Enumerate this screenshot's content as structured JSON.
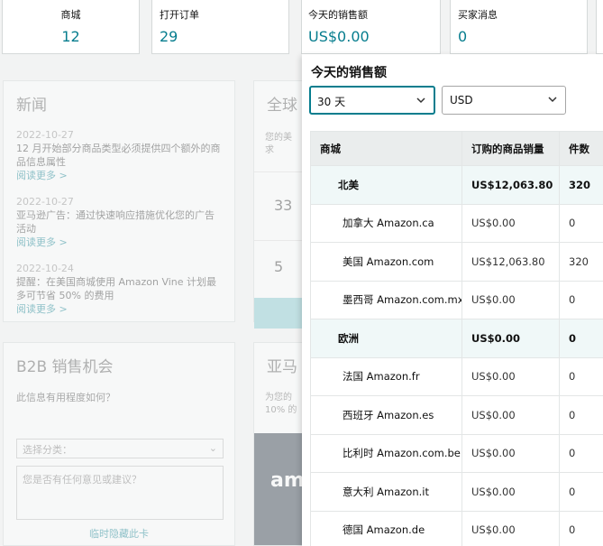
{
  "cards": [
    {
      "label": "商城",
      "value": "12"
    },
    {
      "label": "打开订单",
      "value": "29"
    },
    {
      "label": "今天的销售额",
      "value": "US$0.00"
    },
    {
      "label": "买家消息",
      "value": "0"
    }
  ],
  "news": {
    "title": "新闻",
    "items": [
      {
        "date": "2022-10-27",
        "text": "12 月开始部分商品类型必须提供四个额外的商品信息属性",
        "link": "阅读更多 >"
      },
      {
        "date": "2022-10-27",
        "text": "亚马逊广告：通过快速响应措施优化您的广告活动",
        "link": "阅读更多 >"
      },
      {
        "date": "2022-10-24",
        "text": "提醒：在美国商城使用 Amazon Vine 计划最多可节省 50% 的费用",
        "link": "阅读更多 >"
      }
    ]
  },
  "b2b": {
    "title": "B2B 销售机会",
    "question": "此信息有用程度如何？",
    "select_placeholder": "选择分类：",
    "text_placeholder": "您是否有任何意见或建议？",
    "hide_link": "临时隐藏此卡"
  },
  "global": {
    "title": "全球",
    "desc_line1": "您的美",
    "desc_line2": "求",
    "num1": "33",
    "num2": "5"
  },
  "amazon": {
    "title": "亚马",
    "desc_line1": "为您的",
    "desc_line2": "10% 的",
    "logo": "am"
  },
  "panel": {
    "title": "今天的销售额",
    "period": "30 天",
    "currency": "USD",
    "headers": [
      "商城",
      "订购的商品销量",
      "件数"
    ],
    "rows": [
      {
        "type": "region",
        "market": "北美",
        "sales": "US$12,063.80",
        "units": "320"
      },
      {
        "type": "child",
        "market": "加拿大 Amazon.ca",
        "sales": "US$0.00",
        "units": "0"
      },
      {
        "type": "child",
        "market": "美国 Amazon.com",
        "sales": "US$12,063.80",
        "units": "320"
      },
      {
        "type": "child",
        "market": "墨西哥 Amazon.com.mx",
        "sales": "US$0.00",
        "units": "0"
      },
      {
        "type": "region",
        "market": "欧洲",
        "sales": "US$0.00",
        "units": "0"
      },
      {
        "type": "child",
        "market": "法国 Amazon.fr",
        "sales": "US$0.00",
        "units": "0"
      },
      {
        "type": "child",
        "market": "西班牙 Amazon.es",
        "sales": "US$0.00",
        "units": "0"
      },
      {
        "type": "child",
        "market": "比利时 Amazon.com.be",
        "sales": "US$0.00",
        "units": "0"
      },
      {
        "type": "child",
        "market": "意大利 Amazon.it",
        "sales": "US$0.00",
        "units": "0"
      },
      {
        "type": "child",
        "market": "德国 Amazon.de",
        "sales": "US$0.00",
        "units": "0"
      }
    ]
  }
}
